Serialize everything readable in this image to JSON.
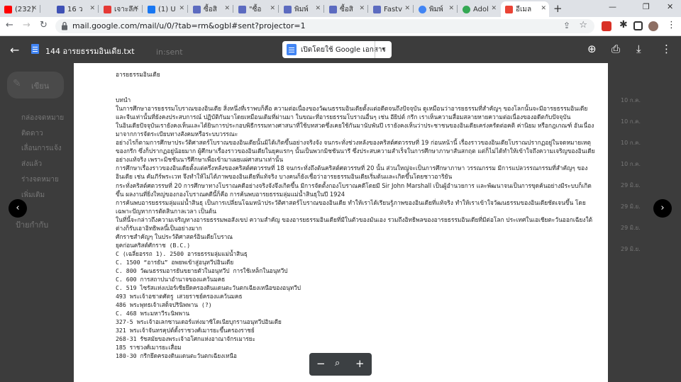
{
  "tabs": [
    {
      "label": "(232) ",
      "color": "#ff0000"
    },
    {
      "label": "16 ว",
      "color": "#3f51b5"
    },
    {
      "label": "เจาะลึก",
      "color": "#e53935"
    },
    {
      "label": "(1) U",
      "color": "#1877f2"
    },
    {
      "label": "ซื้อสิ",
      "color": "#5c6bc0"
    },
    {
      "label": "\"ซื้อ",
      "color": "#5c6bc0"
    },
    {
      "label": "พิมพ์",
      "color": "#5c6bc0"
    },
    {
      "label": "ซื้อสิ",
      "color": "#5c6bc0"
    },
    {
      "label": "Fastv",
      "color": "#5c6bc0"
    },
    {
      "label": "พิมพ์",
      "color": "#4285f4"
    },
    {
      "label": "Adol",
      "color": "#34a853"
    },
    {
      "label": "อีเมล",
      "color": "#ea4335"
    }
  ],
  "new_tab": "+",
  "window_controls": {
    "minimize": "—",
    "restore": "❐",
    "close": "✕"
  },
  "address": {
    "url": "mail.google.com/mail/u/0/?tab=rm&ogbl#sent?projector=1"
  },
  "gmail_bg": {
    "compose": "เขียน",
    "search_placeholder": "in:sent",
    "sidebar": [
      "กล่องจดหมาย",
      "ติดดาว",
      "เลื่อนการแจ้ง",
      "ส่งแล้ว",
      "ร่างจดหมาย",
      "เพิ่มเติม"
    ],
    "labels_heading": "ป้ายกำกับ",
    "dates": [
      "10 ก.ค.",
      "10 ก.ค.",
      "10 ก.ค.",
      "10 ก.ค.",
      "29 มิ.ย.",
      "29 มิ.ย.",
      "29 มิ.ย.",
      "29 มิ.ย."
    ]
  },
  "viewer": {
    "filename": "144 อารยธรรมอินเดีย.txt",
    "open_with": "เปิดโดยใช้ Google เอกสาร",
    "open_dropdown": "▾"
  },
  "document": {
    "title": "อารยธรรมอินเดีย",
    "intro_heading": "บทนำ",
    "paragraphs": [
      "ในการศึกษาอารยธรรมโบราณของอินเดีย สิ่งหนึ่งที่เราพบก็คือ ความต่อเนื่องของวัฒนธรรมอินเดียตั้งแต่อดีตจนถึงปัจจุบัน ดูเหมือนว่าอารยธรรมที่สำคัญๆ ของโลกนั้นจะมีอารยธรรมอินเดียและจีนเท่านั้นที่ยังคงประสบการณ์ ปฏิบัติกันมาโดยเหมือนเดิมที่ผ่านมา ในขณะที่อารยธรรมโบราณอื่นๆ เช่น อียิปต์ กรีก เราเห็นความสื่อมสลายหายความต่อเนื่องของอดีตกับปัจจุบัน",
      "ในอินเดียปัจจุบันเรายังคงเห็นและได้ยินการประกอบพิธีกรรมทางศาสนาที่ใช้บทสวดซึ่งเคยใช้กันมานับพันปี เรายังคงเห็นว่าประชาชนของอินเดียเคร่งครัดต่อคติ ค่านิยม หรือกฎเกณฑ์ อันเนื่องมาจากการจัดระเบียบทางสังคมหรือระบบวรรณะ",
      "อย่างไรก็ตามการศึกษาประวัติศาสตร์โบราณของอินเดียนั้นมิได้เกิดขึ้นอย่างจริงจัง จนกระทั่งช่วงหลังของคริสต์ศตวรรษที่ 19 ก่อนหน้านี้ เรื่องราวของอินเดียโบราณปรากฏอยู่ในจดหมายเหตุของกรีก ซึ่งก็ปรากฏอยู่น้อยมาก ผู้ศึกษาเรื่องราวของอินเดียในยุคแรกๆ นั้นเป็นพวกมิชชันนารี ซึ่งประสบความสำเร็จในการศึกษาภาษาสันสกฤต แต่ก็ไม่ได้ทำให้เข้าใจถึงความเจริญของอินเดียอย่างแท้จริง เพราะมิชชันนารีศึกษาเพื่อเข้ามาเผยแผ่ศาสนาเท่านั้น",
      "การศึกษาเรื่องราวของอินเดียตั้งแต่ครึ่งหลังของคริสต์ศตวรรษที่ 18 จนกระทั่งถึงต้นคริสต์ศตวรรษที่ 20 นั้น ส่วนใหญ่จะเป็นการศึกษาภาษา วรรณกรรม มีการแปลวรรณกรรมที่สำคัญๆ ของอินเดีย เช่น คัมภีร์พระเวท จึงทำให้ไม่ได้ภาพของอินเดียที่แท้จริง บางคนก็ยังเชื่อว่าอารยธรรมอินเดียเริ่มต้นและเกิดขึ้นโดยชาวอาริยัน",
      "กระทั่งคริสต์ศตวรรษที่ 20 การศึกษาทางโบราณคดีอย่างจริงจังจึงเกิดขึ้น มีการจัดตั้งกองโบราณคดีโดยมี Sir John Marshall เป็นผู้อำนวยการ และพัฒนาจนเป็นการขุดค้นอย่างมีระบบก็เกิดขึ้น ผลงานที่ยิ่งใหญ่ของกองโบราณคดีนี้ก็คือ การค้นพบอารยธรรมลุ่มแม่น้ำสินธุในปี 1924",
      "การค้นพบอารยธรรมลุ่มแม่น้ำสินธุ เป็นการเปลี่ยนโฉมหน้าประวัติศาสตร์โบราณของอินเดีย ทำให้เราได้เรียนรู้ภาพของอินเดียที่แท้จริง ทำให้เราเข้าใจวัฒนธรรมของอินเดียชัดเจนขึ้น โดยเฉพาะปัญหาการตัดสินกาลเวลา เป็นต้น",
      "ในที่นี้จะกล่าวถึงความเจริญทางอารยธรรมพอสังเขป ความสำคัญ ของอารยธรรมอินเดียที่มีในตัวของมันเอง รวมถึงอิทธิพลของอารยธรรมอินเดียที่มีต่อโลก ประเทศในเอเชียตะวันออกเฉียงใต้ต่างก็รับเอาอิทธิพลนี้เป็นอย่างมาก"
    ],
    "timeline_heading": "ศักราชสำคัญๆ ในประวัติศาสตร์อินเดียโบราณ",
    "timeline_sub": "ยุคก่อนคริสต์ศักราช (B.C.)",
    "timeline": [
      "C (เฉลี่ยอรรถ 1). 2500 อารยธรรมลุ่มแม่น้ำสินธุ",
      "C. 1500 “อารยัน” อพยพเข้าสู่อนุทวีปอินเดีย",
      "C. 800 วัฒนธรรมอารยันขยายตัวในอนุทวีป การใช้เหล็กในอนุทวีป",
      "C. 600 การสถาปนาอำนาจของแคว้นมคธ",
      "C. 519 ไซรัสแห่งเปอร์เซียยึดครองดินแดนตะวันตกเฉียงเหนือของอนุทวีป",
      "493 พระเจ้าอชาตศัตรู เสวยราชย์ครองแคว้นมคธ",
      "486 พระพุทธเจ้าเสด็จปรินิพพาน (?)",
      "C. 468 พระมหาวีระนิพพาน",
      "327-5 พระเจ้าอเลกซานเดอร์แห่งมาซิโดเนียบุกรานอนุทวีปอินเดีย",
      "321 พระเจ้าจันทรคุปต์ตั้งราชวงศ์เมารยะขึ้นครองราชย์",
      "268-31 รัชสมัยของพระเจ้าอโศกแห่งอาณาจักรเมารยะ",
      "185 ราชวงศ์เมารยะเสื่อม",
      "180-30 กรีกยึดครองดินแดนตะวันตกเฉียงเหนือ"
    ]
  },
  "zoom": {
    "minus": "−",
    "search": "⌕",
    "plus": "+"
  }
}
